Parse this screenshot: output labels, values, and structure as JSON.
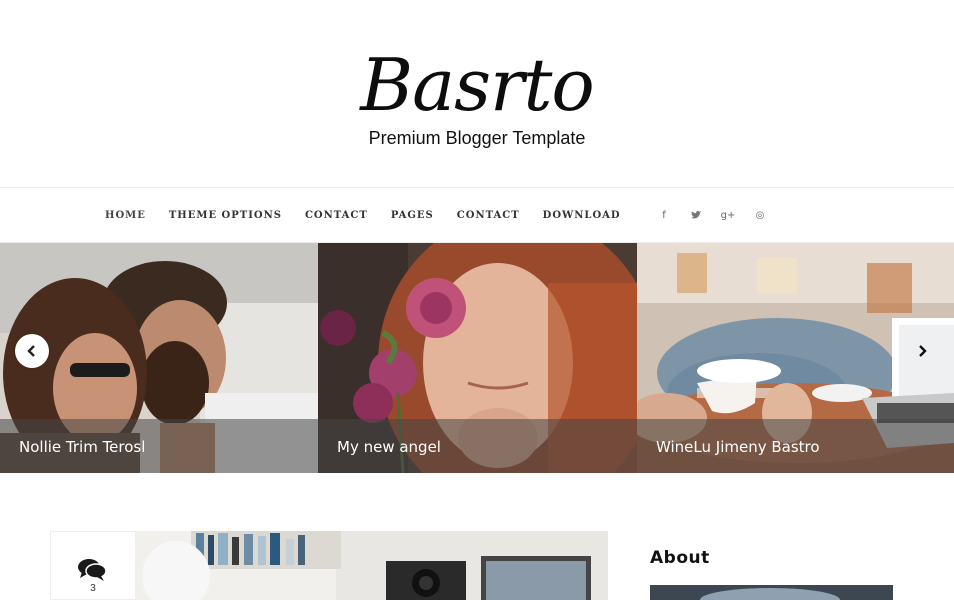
{
  "header": {
    "logo": "Basrto",
    "tagline": "Premium Blogger Template"
  },
  "nav": {
    "items": [
      {
        "label": "HOME"
      },
      {
        "label": "THEME OPTIONS"
      },
      {
        "label": "CONTACT"
      },
      {
        "label": "PAGES"
      },
      {
        "label": "CONTACT"
      },
      {
        "label": "DOWNLOAD"
      }
    ],
    "social": [
      {
        "icon": "facebook-icon",
        "glyph": "f"
      },
      {
        "icon": "twitter-icon",
        "glyph": "t"
      },
      {
        "icon": "google-plus-icon",
        "glyph": "g+"
      },
      {
        "icon": "dribbble-icon",
        "glyph": "◎"
      }
    ]
  },
  "slider": {
    "slides": [
      {
        "title": "Nollie Trim Terosl"
      },
      {
        "title": "My new angel"
      },
      {
        "title": "WineLu Jimeny Bastro"
      }
    ],
    "prev_icon": "chevron-left-icon",
    "next_icon": "chevron-right-icon"
  },
  "post": {
    "comment_count": "3",
    "comment_icon": "comments-icon"
  },
  "sidebar": {
    "about_title": "About"
  }
}
